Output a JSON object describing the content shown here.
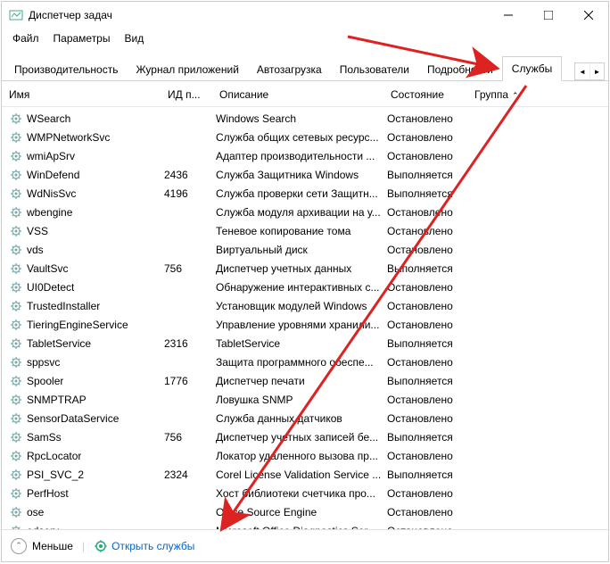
{
  "window": {
    "title": "Диспетчер задач"
  },
  "menu": {
    "file": "Файл",
    "options": "Параметры",
    "view": "Вид"
  },
  "tabs": [
    {
      "label": "Производительность"
    },
    {
      "label": "Журнал приложений"
    },
    {
      "label": "Автозагрузка"
    },
    {
      "label": "Пользователи"
    },
    {
      "label": "Подробности"
    },
    {
      "label": "Службы"
    }
  ],
  "headers": {
    "name": "Имя",
    "pid": "ИД п...",
    "desc": "Описание",
    "state": "Состояние",
    "group": "Группа"
  },
  "states": {
    "stopped": "Остановлено",
    "running": "Выполняется"
  },
  "services": [
    {
      "name": "WSearch",
      "pid": "",
      "desc": "Windows Search",
      "state": "Остановлено"
    },
    {
      "name": "WMPNetworkSvc",
      "pid": "",
      "desc": "Служба общих сетевых ресурс...",
      "state": "Остановлено"
    },
    {
      "name": "wmiApSrv",
      "pid": "",
      "desc": "Адаптер производительности ...",
      "state": "Остановлено"
    },
    {
      "name": "WinDefend",
      "pid": "2436",
      "desc": "Служба Защитника Windows",
      "state": "Выполняется"
    },
    {
      "name": "WdNisSvc",
      "pid": "4196",
      "desc": "Служба проверки сети Защитн...",
      "state": "Выполняется"
    },
    {
      "name": "wbengine",
      "pid": "",
      "desc": "Служба модуля архивации на у...",
      "state": "Остановлено"
    },
    {
      "name": "VSS",
      "pid": "",
      "desc": "Теневое копирование тома",
      "state": "Остановлено"
    },
    {
      "name": "vds",
      "pid": "",
      "desc": "Виртуальный диск",
      "state": "Остановлено"
    },
    {
      "name": "VaultSvc",
      "pid": "756",
      "desc": "Диспетчер учетных данных",
      "state": "Выполняется"
    },
    {
      "name": "UI0Detect",
      "pid": "",
      "desc": "Обнаружение интерактивных с...",
      "state": "Остановлено"
    },
    {
      "name": "TrustedInstaller",
      "pid": "",
      "desc": "Установщик модулей Windows",
      "state": "Остановлено"
    },
    {
      "name": "TieringEngineService",
      "pid": "",
      "desc": "Управление уровнями хранили...",
      "state": "Остановлено"
    },
    {
      "name": "TabletService",
      "pid": "2316",
      "desc": "TabletService",
      "state": "Выполняется"
    },
    {
      "name": "sppsvc",
      "pid": "",
      "desc": "Защита программного обеспе...",
      "state": "Остановлено"
    },
    {
      "name": "Spooler",
      "pid": "1776",
      "desc": "Диспетчер печати",
      "state": "Выполняется"
    },
    {
      "name": "SNMPTRAP",
      "pid": "",
      "desc": "Ловушка SNMP",
      "state": "Остановлено"
    },
    {
      "name": "SensorDataService",
      "pid": "",
      "desc": "Служба данных датчиков",
      "state": "Остановлено"
    },
    {
      "name": "SamSs",
      "pid": "756",
      "desc": "Диспетчер учетных записей бе...",
      "state": "Выполняется"
    },
    {
      "name": "RpcLocator",
      "pid": "",
      "desc": "Локатор удаленного вызова пр...",
      "state": "Остановлено"
    },
    {
      "name": "PSI_SVC_2",
      "pid": "2324",
      "desc": "Corel License Validation Service ...",
      "state": "Выполняется"
    },
    {
      "name": "PerfHost",
      "pid": "",
      "desc": "Хост библиотеки счетчика про...",
      "state": "Остановлено"
    },
    {
      "name": "ose",
      "pid": "",
      "desc": "Office Source Engine",
      "state": "Остановлено"
    },
    {
      "name": "odserv",
      "pid": "",
      "desc": "Microsoft Office Diagnostics Ser...",
      "state": "Остановлено"
    }
  ],
  "statusbar": {
    "less": "Меньше",
    "open_services": "Открыть службы"
  }
}
